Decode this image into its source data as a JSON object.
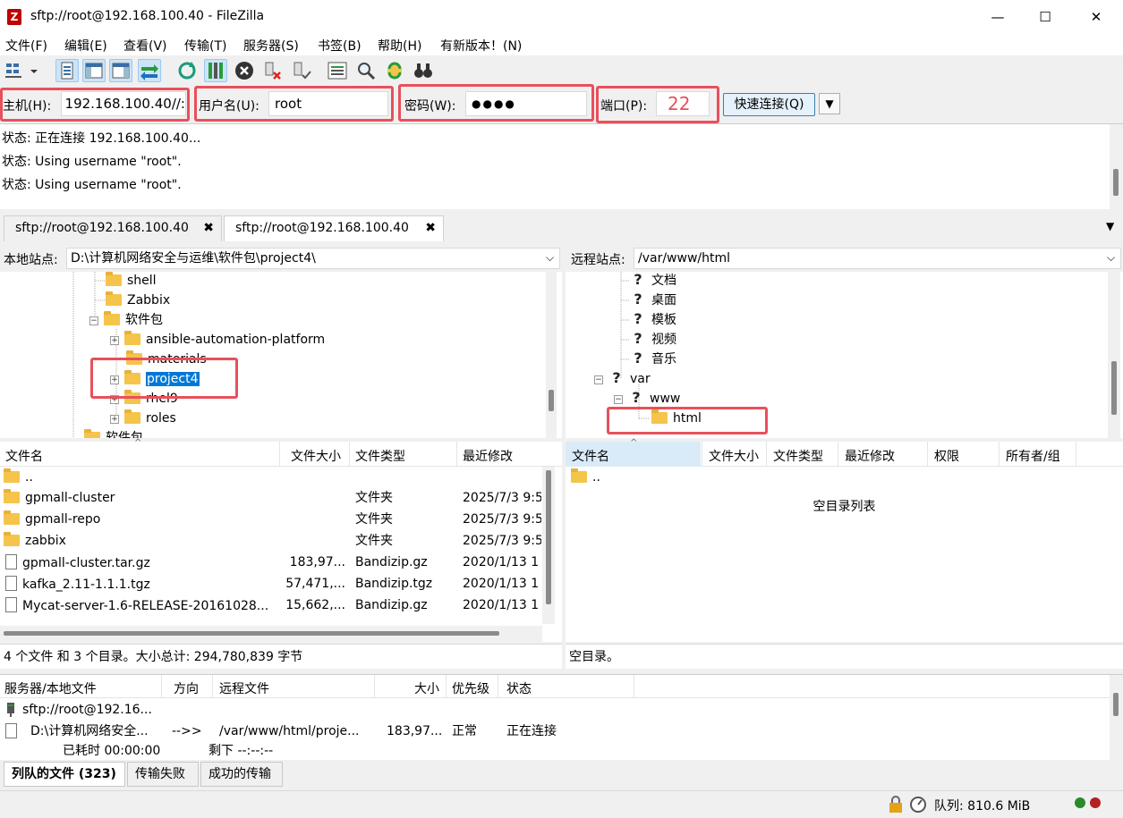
{
  "window": {
    "title": "sftp://root@192.168.100.40 - FileZilla",
    "app_icon": "Z"
  },
  "menu": [
    "文件(F)",
    "编辑(E)",
    "查看(V)",
    "传输(T)",
    "服务器(S)",
    "书签(B)",
    "帮助(H)",
    "有新版本！(N)"
  ],
  "quickconnect": {
    "host_label": "主机(H):",
    "host_value": "://192.168.100.40",
    "user_label": "用户名(U):",
    "user_value": "root",
    "pass_label": "密码(W):",
    "pass_value": "●●●●",
    "port_label": "端口(P):",
    "port_value": "22",
    "connect_label": "快速连接(Q)",
    "dropdown_glyph": "▼"
  },
  "log": [
    "状态:  正在连接 192.168.100.40...",
    "状态:  Using username \"root\".",
    "状态:  Using username \"root\"."
  ],
  "tabs": [
    {
      "label": "sftp://root@192.168.100.40",
      "close": "✖"
    },
    {
      "label": "sftp://root@192.168.100.40",
      "close": "✖"
    }
  ],
  "local": {
    "site_label": "本地站点:",
    "path": "D:\\计算机网络安全与运维\\软件包\\project4\\",
    "tree": [
      "shell",
      "Zabbix",
      "软件包",
      "ansible-automation-platform",
      "materials",
      "project4",
      "rhel9",
      "roles",
      "软件包"
    ],
    "columns": [
      "文件名",
      "文件大小",
      "文件类型",
      "最近修改"
    ],
    "files": [
      {
        "name": "..",
        "size": "",
        "type": "",
        "modified": ""
      },
      {
        "name": "gpmall-cluster",
        "size": "",
        "type": "文件夹",
        "modified": "2025/7/3 9:5"
      },
      {
        "name": "gpmall-repo",
        "size": "",
        "type": "文件夹",
        "modified": "2025/7/3 9:5"
      },
      {
        "name": "zabbix",
        "size": "",
        "type": "文件夹",
        "modified": "2025/7/3 9:5"
      },
      {
        "name": "gpmall-cluster.tar.gz",
        "size": "183,97...",
        "type": "Bandizip.gz",
        "modified": "2020/1/13 1"
      },
      {
        "name": "kafka_2.11-1.1.1.tgz",
        "size": "57,471,...",
        "type": "Bandizip.tgz",
        "modified": "2020/1/13 1"
      },
      {
        "name": "Mycat-server-1.6-RELEASE-20161028...",
        "size": "15,662,...",
        "type": "Bandizip.gz",
        "modified": "2020/1/13 1"
      }
    ],
    "status": "4 个文件 和 3 个目录。大小总计: 294,780,839 字节"
  },
  "remote": {
    "site_label": "远程站点:",
    "path": "/var/www/html",
    "tree": [
      "文档",
      "桌面",
      "模板",
      "视频",
      "音乐",
      "var",
      "www",
      "html"
    ],
    "columns": [
      "文件名",
      "文件大小",
      "文件类型",
      "最近修改",
      "权限",
      "所有者/组"
    ],
    "files": [
      {
        "name": ".."
      }
    ],
    "empty_text": "空目录列表",
    "status": "空目录。"
  },
  "queue": {
    "columns": [
      "服务器/本地文件",
      "方向",
      "远程文件",
      "大小",
      "优先级",
      "状态"
    ],
    "server": "sftp://root@192.16...",
    "item": {
      "local": "D:\\计算机网络安全...",
      "direction": "-->>",
      "remote": "/var/www/html/proje...",
      "size": "183,97...",
      "priority": "正常",
      "status": "正在连接"
    },
    "elapsed": "已耗时 00:00:00",
    "remaining": "剩下 --:--:--"
  },
  "bottom_tabs": [
    "列队的文件 (323)",
    "传输失败",
    "成功的传输"
  ],
  "statusbar": {
    "queue": "队列: 810.6 MiB"
  },
  "colors": {
    "highlight": "#e8505b",
    "selection": "#0078d7"
  }
}
